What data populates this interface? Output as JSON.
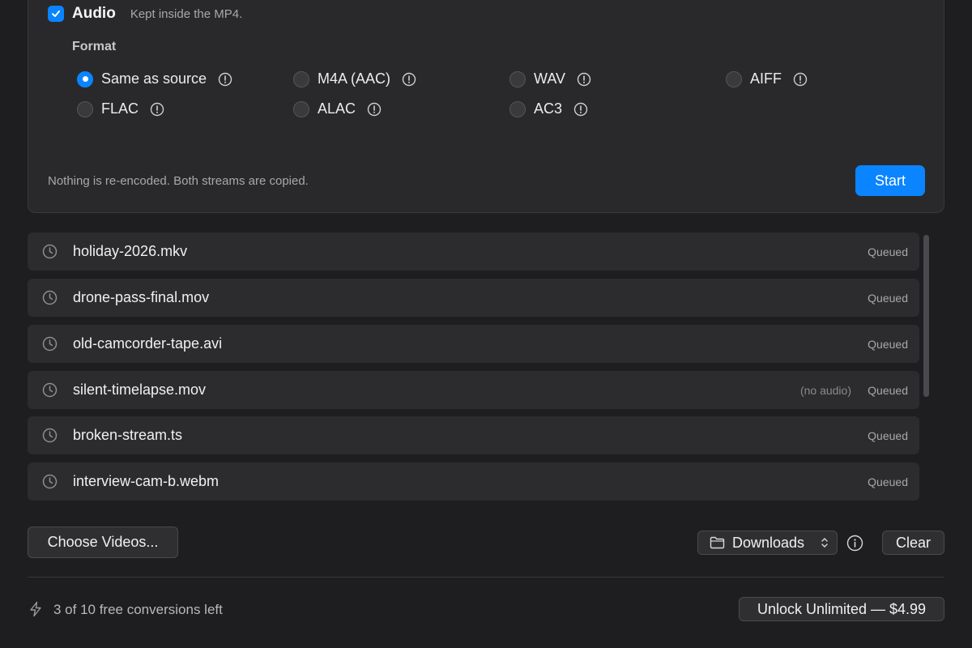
{
  "audio": {
    "checked": true,
    "label": "Audio",
    "subtitle": "Kept inside the MP4."
  },
  "format": {
    "label": "Format",
    "selected": "Same as source",
    "options": [
      {
        "label": "Same as source",
        "selected": true
      },
      {
        "label": "M4A (AAC)",
        "selected": false
      },
      {
        "label": "WAV",
        "selected": false
      },
      {
        "label": "AIFF",
        "selected": false
      },
      {
        "label": "FLAC",
        "selected": false
      },
      {
        "label": "ALAC",
        "selected": false
      },
      {
        "label": "AC3",
        "selected": false
      }
    ]
  },
  "note": "Nothing is re-encoded. Both streams are copied.",
  "start_label": "Start",
  "files": [
    {
      "name": "holiday-2026.mkv",
      "status": "Queued",
      "extra": ""
    },
    {
      "name": "drone-pass-final.mov",
      "status": "Queued",
      "extra": ""
    },
    {
      "name": "old-camcorder-tape.avi",
      "status": "Queued",
      "extra": ""
    },
    {
      "name": "silent-timelapse.mov",
      "status": "Queued",
      "extra": "(no audio)"
    },
    {
      "name": "broken-stream.ts",
      "status": "Queued",
      "extra": ""
    },
    {
      "name": "interview-cam-b.webm",
      "status": "Queued",
      "extra": ""
    }
  ],
  "footer": {
    "choose_label": "Choose Videos...",
    "destination_label": "Downloads",
    "clear_label": "Clear",
    "free_left": "3 of 10 free conversions left",
    "unlock_label": "Unlock Unlimited — $4.99"
  },
  "colors": {
    "accent": "#0a84ff",
    "background": "#1e1e20",
    "panel": "#29292b"
  },
  "icons": {
    "checkbox": "checkmark-icon",
    "option_info": "exclamation-circle-icon",
    "file_status": "clock-icon",
    "destination": "folder-icon",
    "destination_chevron": "chevron-up-down-icon",
    "info": "info-icon",
    "free": "bolt-icon"
  }
}
